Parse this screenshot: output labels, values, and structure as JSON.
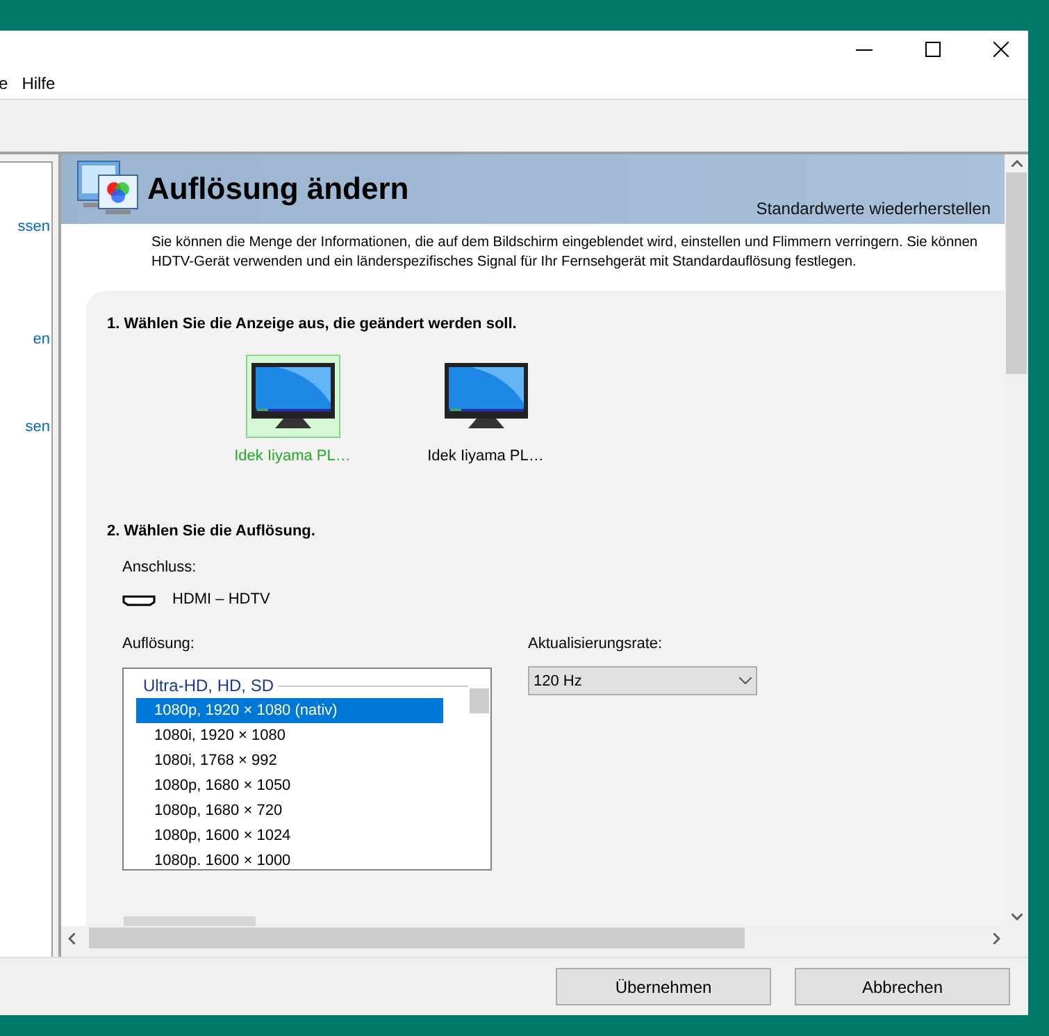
{
  "menu": [
    "e",
    "Hilfe"
  ],
  "sidebar": {
    "links": [
      "ssen",
      "en",
      "sen"
    ]
  },
  "header": {
    "title": "Auflösung ändern",
    "restore_link": "Standardwerte wiederherstellen"
  },
  "description_lines": [
    "Sie können die Menge der Informationen, die auf dem Bildschirm eingeblendet wird, einstellen und Flimmern verringern. Sie können",
    "HDTV-Gerät verwenden und ein länderspezifisches Signal für Ihr Fernsehgerät mit Standardauflösung festlegen."
  ],
  "step1": {
    "heading": "1. Wählen Sie die Anzeige aus, die geändert werden soll.",
    "displays": [
      {
        "label": "Idek Iiyama PL…",
        "selected": true
      },
      {
        "label": "Idek Iiyama PL…",
        "selected": false
      }
    ]
  },
  "step2": {
    "heading": "2. Wählen Sie die Auflösung.",
    "connection_label": "Anschluss:",
    "connection": "HDMI – HDTV",
    "resolution_label": "Auflösung:",
    "group": "Ultra-HD, HD, SD",
    "resolutions": [
      {
        "text": "1080p, 1920 × 1080 (nativ)",
        "selected": true
      },
      {
        "text": "1080i, 1920 × 1080",
        "selected": false
      },
      {
        "text": "1080i, 1768 × 992",
        "selected": false
      },
      {
        "text": "1080p, 1680 × 1050",
        "selected": false
      },
      {
        "text": "1080p, 1680 × 720",
        "selected": false
      },
      {
        "text": "1080p, 1600 × 1024",
        "selected": false
      },
      {
        "text": "1080p. 1600 × 1000",
        "selected": false
      }
    ],
    "refresh_label": "Aktualisierungsrate:",
    "refresh_value": "120 Hz"
  },
  "buttons": [
    "Übernehmen",
    "Abbrechen"
  ]
}
